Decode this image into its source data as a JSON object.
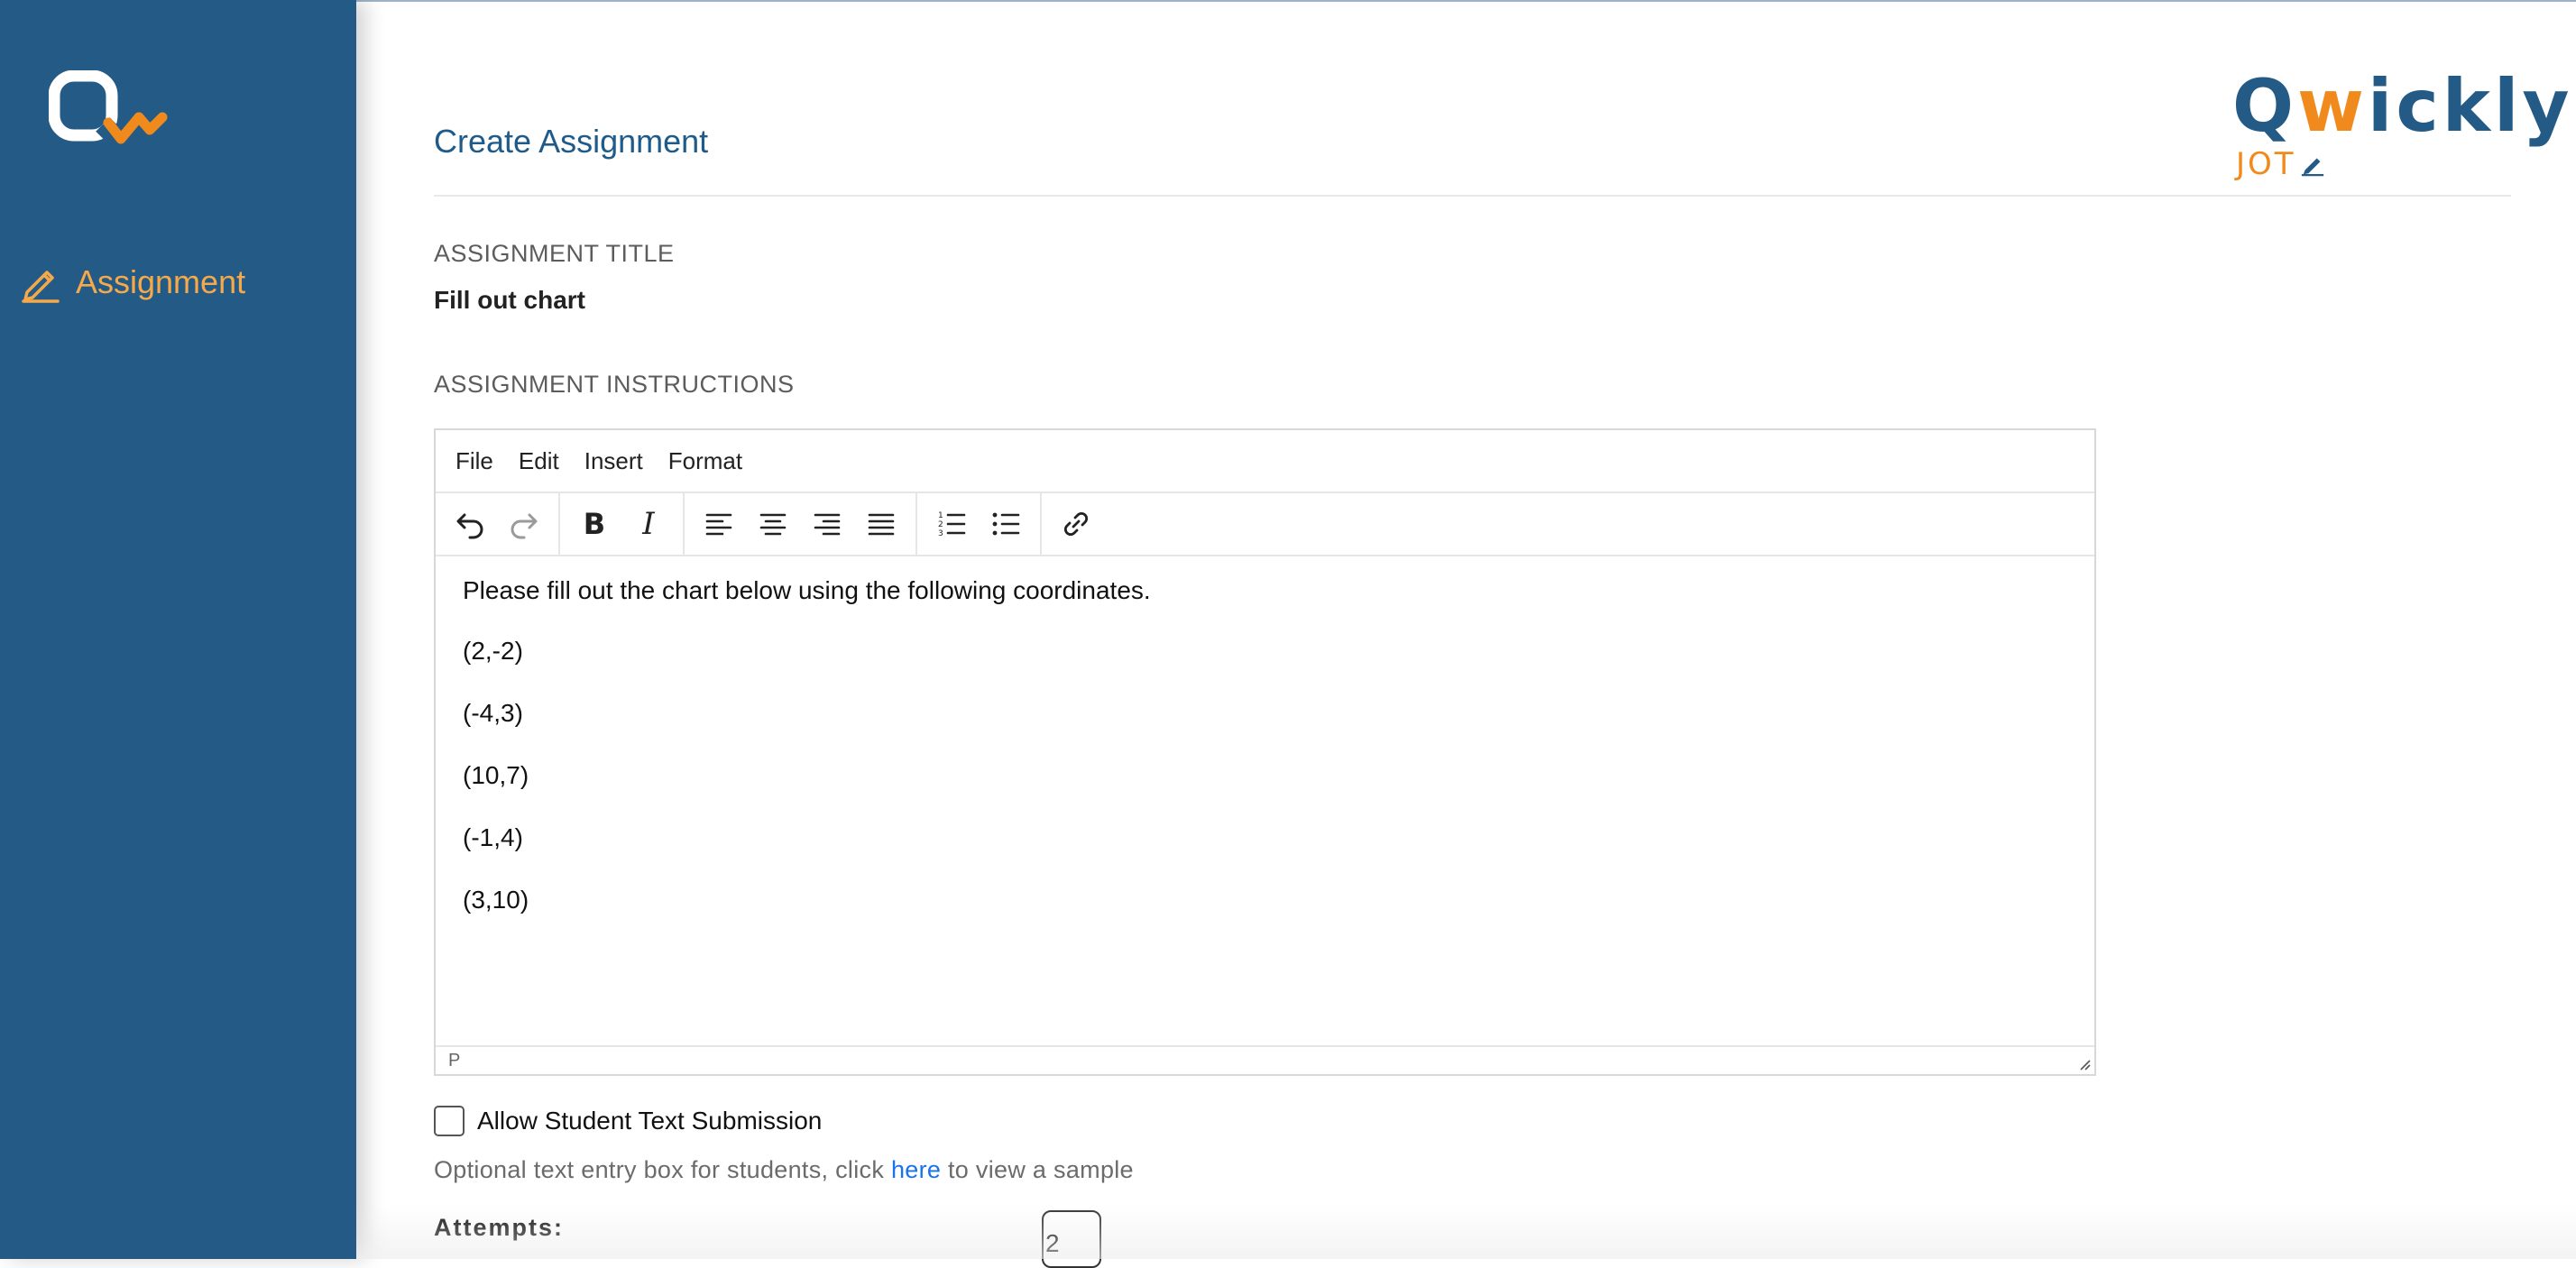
{
  "sidebar": {
    "nav_item_label": "Assignment"
  },
  "header": {
    "page_title": "Create Assignment",
    "brand_word_prefix": "Q",
    "brand_word_w": "w",
    "brand_word_suffix": "ickly",
    "brand_sub": "JOT"
  },
  "form": {
    "title_label": "ASSIGNMENT TITLE",
    "title_value": "Fill out chart",
    "instructions_label": "ASSIGNMENT INSTRUCTIONS"
  },
  "editor": {
    "menu": [
      "File",
      "Edit",
      "Insert",
      "Format"
    ],
    "toolbar_icons": [
      "undo-icon",
      "redo-icon",
      "bold-icon",
      "italic-icon",
      "align-left-icon",
      "align-center-icon",
      "align-right-icon",
      "align-justify-icon",
      "numbered-list-icon",
      "bulleted-list-icon",
      "link-icon"
    ],
    "bold_glyph": "B",
    "italic_glyph": "I",
    "paragraphs": [
      "Please fill out the chart below using the following coordinates.",
      "(2,-2)",
      "(-4,3)",
      "(10,7)",
      "(-1,4)",
      "(3,10)"
    ],
    "status_path": "P"
  },
  "text_submission": {
    "checkbox_label": "Allow Student Text Submission",
    "checked": false,
    "hint_before": "Optional text entry box for students, click ",
    "hint_link": "here",
    "hint_after": " to view a sample"
  },
  "attempts": {
    "label": "Attempts:",
    "value": "2"
  },
  "colors": {
    "sidebar": "#245b86",
    "accent_orange": "#f5a94a",
    "title_blue": "#1e5b8a",
    "link_blue": "#1a73e8"
  }
}
